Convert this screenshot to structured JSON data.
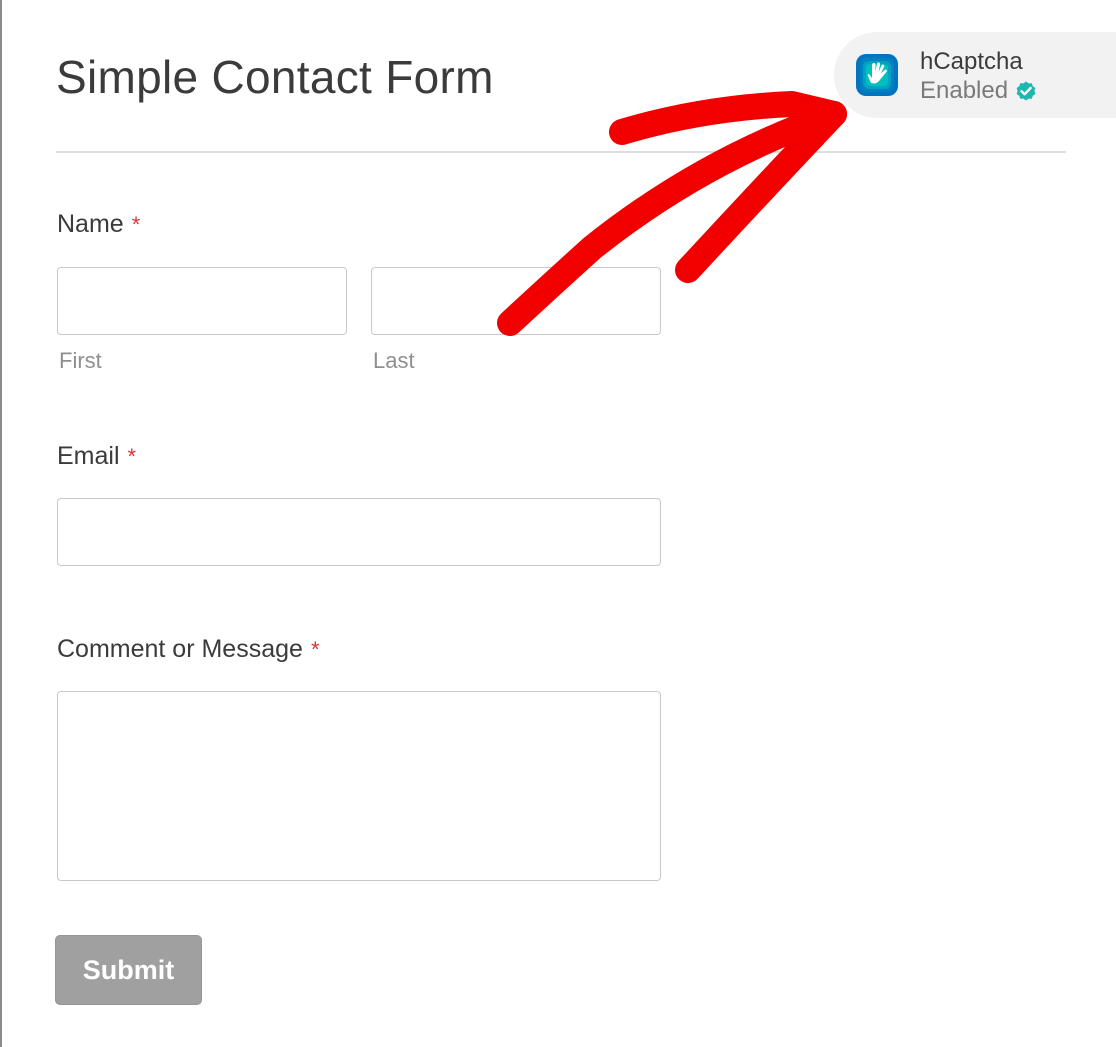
{
  "form": {
    "title": "Simple Contact Form",
    "fields": {
      "name": {
        "label": "Name",
        "required_mark": "*",
        "first_sublabel": "First",
        "last_sublabel": "Last",
        "first_value": "",
        "last_value": ""
      },
      "email": {
        "label": "Email",
        "required_mark": "*",
        "value": ""
      },
      "message": {
        "label": "Comment or Message",
        "required_mark": "*",
        "value": ""
      }
    },
    "submit_label": "Submit"
  },
  "captcha_badge": {
    "title": "hCaptcha",
    "status": "Enabled",
    "logo_icon": "hcaptcha-hand-logo-icon",
    "status_icon": "verified-check-icon",
    "status_color": "#1fb8b0"
  },
  "annotation": {
    "arrow_color": "#f20000"
  },
  "colors": {
    "required": "#d63638",
    "submit_bg": "#a0a0a0",
    "badge_bg": "#f2f2f2"
  }
}
